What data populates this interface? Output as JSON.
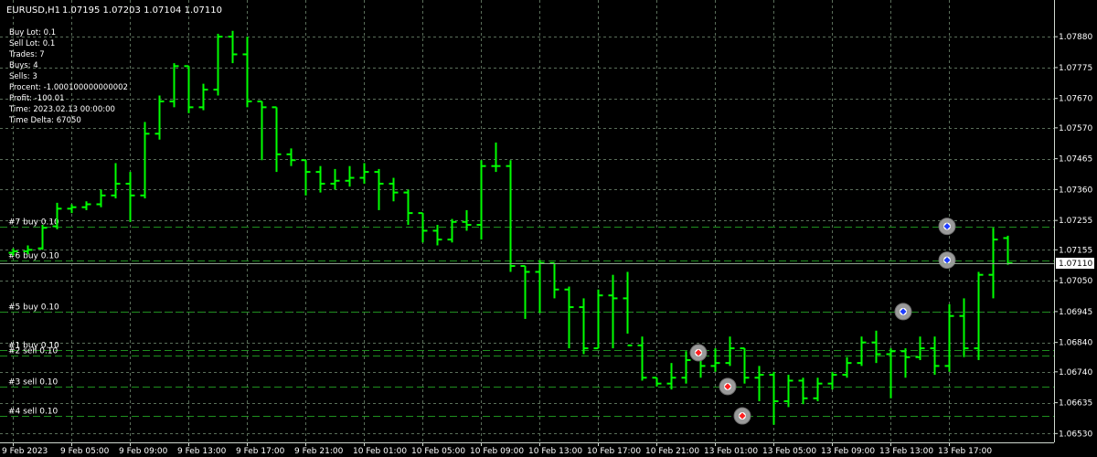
{
  "header": {
    "symbol": "EURUSD,H1",
    "ohlc": "1.07195 1.07203 1.07104 1.07110"
  },
  "info_panel": [
    "Buy Lot: 0.1",
    "Sell Lot: 0.1",
    "Trades: 7",
    "Buys: 4",
    "Sells: 3",
    "Procent: -1.000100000000002",
    "Profit: -100.01",
    "Time: 2023.02.13 00:00:00",
    "Time Delta: 67050"
  ],
  "current_price": "1.07110",
  "colors": {
    "background": "#000000",
    "grid": "#5a6e5a",
    "bar": "#00ff00",
    "order_line": "#1f8f1f",
    "price_label_bg": "#ffffff"
  },
  "order_labels": [
    {
      "text": "#7 buy 0.10",
      "price": 1.07235
    },
    {
      "text": "#6 buy 0.10",
      "price": 1.0712
    },
    {
      "text": "#5 buy 0.10",
      "price": 1.06945
    },
    {
      "text": "#1 buy 0.10",
      "price": 1.06815
    },
    {
      "text": "#2 sell 0.10",
      "price": 1.06795
    },
    {
      "text": "#3 sell 0.10",
      "price": 1.0669
    },
    {
      "text": "#4 sell 0.10",
      "price": 1.0659
    }
  ],
  "trade_markers": [
    {
      "type": "sell",
      "bar": 47,
      "price": 1.06805
    },
    {
      "type": "sell",
      "bar": 49,
      "price": 1.0669
    },
    {
      "type": "sell",
      "bar": 50,
      "price": 1.0659
    },
    {
      "type": "buy",
      "bar": 61,
      "price": 1.06945
    },
    {
      "type": "buy",
      "bar": 64,
      "price": 1.0712
    },
    {
      "type": "buy",
      "bar": 64,
      "price": 1.07235
    }
  ],
  "chart_data": {
    "type": "ohlc",
    "symbol": "EURUSD",
    "timeframe": "H1",
    "ylim": [
      1.065,
      1.0798
    ],
    "y_ticks": [
      "1.07880",
      "1.07775",
      "1.07670",
      "1.07570",
      "1.07465",
      "1.07360",
      "1.07255",
      "1.07155",
      "1.07050",
      "1.06945",
      "1.06840",
      "1.06740",
      "1.06635",
      "1.06530"
    ],
    "x_ticks": [
      {
        "label": "9 Feb 2023",
        "bar": 0
      },
      {
        "label": "9 Feb 05:00",
        "bar": 4
      },
      {
        "label": "9 Feb 09:00",
        "bar": 8
      },
      {
        "label": "9 Feb 13:00",
        "bar": 12
      },
      {
        "label": "9 Feb 17:00",
        "bar": 16
      },
      {
        "label": "9 Feb 21:00",
        "bar": 20
      },
      {
        "label": "10 Feb 01:00",
        "bar": 24
      },
      {
        "label": "10 Feb 05:00",
        "bar": 28
      },
      {
        "label": "10 Feb 09:00",
        "bar": 32
      },
      {
        "label": "10 Feb 13:00",
        "bar": 36
      },
      {
        "label": "10 Feb 17:00",
        "bar": 40
      },
      {
        "label": "10 Feb 21:00",
        "bar": 44
      },
      {
        "label": "13 Feb 01:00",
        "bar": 48
      },
      {
        "label": "13 Feb 05:00",
        "bar": 52
      },
      {
        "label": "13 Feb 09:00",
        "bar": 56
      },
      {
        "label": "13 Feb 13:00",
        "bar": 60
      },
      {
        "label": "13 Feb 17:00",
        "bar": 64
      }
    ],
    "bars": [
      [
        1.07145,
        1.0716,
        1.07135,
        1.0715
      ],
      [
        1.0715,
        1.0717,
        1.0714,
        1.07155
      ],
      [
        1.0716,
        1.0724,
        1.07155,
        1.0723
      ],
      [
        1.07235,
        1.07315,
        1.07225,
        1.07295
      ],
      [
        1.07295,
        1.0731,
        1.0728,
        1.073
      ],
      [
        1.073,
        1.0732,
        1.0729,
        1.0731
      ],
      [
        1.0731,
        1.0736,
        1.073,
        1.0734
      ],
      [
        1.0734,
        1.0745,
        1.0733,
        1.0738
      ],
      [
        1.0738,
        1.0742,
        1.0725,
        1.0734
      ],
      [
        1.0734,
        1.0759,
        1.0733,
        1.0755
      ],
      [
        1.0755,
        1.0768,
        1.0753,
        1.0766
      ],
      [
        1.0766,
        1.0779,
        1.0764,
        1.0778
      ],
      [
        1.0778,
        1.0778,
        1.0762,
        1.0764
      ],
      [
        1.0764,
        1.0772,
        1.0763,
        1.077
      ],
      [
        1.077,
        1.0789,
        1.0768,
        1.0788
      ],
      [
        1.0788,
        1.079,
        1.0779,
        1.0782
      ],
      [
        1.0782,
        1.0788,
        1.0764,
        1.0766
      ],
      [
        1.0766,
        1.0766,
        1.0746,
        1.0764
      ],
      [
        1.0764,
        1.0764,
        1.0742,
        1.0748
      ],
      [
        1.0748,
        1.075,
        1.0744,
        1.0746
      ],
      [
        1.0746,
        1.0746,
        1.0734,
        1.0742
      ],
      [
        1.0742,
        1.0744,
        1.0735,
        1.0738
      ],
      [
        1.0738,
        1.0743,
        1.0736,
        1.0739
      ],
      [
        1.0739,
        1.0744,
        1.0737,
        1.074
      ],
      [
        1.074,
        1.0745,
        1.0738,
        1.0742
      ],
      [
        1.0742,
        1.0743,
        1.0729,
        1.0738
      ],
      [
        1.0738,
        1.074,
        1.0732,
        1.0735
      ],
      [
        1.0735,
        1.0736,
        1.0724,
        1.0728
      ],
      [
        1.0728,
        1.0728,
        1.0718,
        1.0722
      ],
      [
        1.0722,
        1.0724,
        1.0717,
        1.0719
      ],
      [
        1.0719,
        1.0726,
        1.0718,
        1.0725
      ],
      [
        1.0725,
        1.0729,
        1.0722,
        1.0724
      ],
      [
        1.0724,
        1.0746,
        1.0719,
        1.0744
      ],
      [
        1.0744,
        1.0752,
        1.0742,
        1.0744
      ],
      [
        1.0744,
        1.0746,
        1.0708,
        1.071
      ],
      [
        1.071,
        1.071,
        1.0692,
        1.0708
      ],
      [
        1.0708,
        1.0712,
        1.0694,
        1.0711
      ],
      [
        1.0711,
        1.0711,
        1.0699,
        1.0702
      ],
      [
        1.0702,
        1.0703,
        1.0682,
        1.0696
      ],
      [
        1.0696,
        1.0699,
        1.068,
        1.0682
      ],
      [
        1.0682,
        1.0702,
        1.0682,
        1.07
      ],
      [
        1.07,
        1.0707,
        1.0682,
        1.0699
      ],
      [
        1.0699,
        1.0708,
        1.0687,
        1.0683
      ],
      [
        1.0683,
        1.0686,
        1.0671,
        1.0672
      ],
      [
        1.0672,
        1.0672,
        1.0669,
        1.067
      ],
      [
        1.067,
        1.0677,
        1.0668,
        1.0672
      ],
      [
        1.0672,
        1.0681,
        1.067,
        1.0678
      ],
      [
        1.0678,
        1.0681,
        1.0672,
        1.0676
      ],
      [
        1.0676,
        1.0682,
        1.0674,
        1.0677
      ],
      [
        1.0677,
        1.0686,
        1.0676,
        1.0682
      ],
      [
        1.0682,
        1.0682,
        1.067,
        1.0672
      ],
      [
        1.0672,
        1.0676,
        1.0664,
        1.0673
      ],
      [
        1.0673,
        1.0674,
        1.0656,
        1.0664
      ],
      [
        1.0664,
        1.0673,
        1.0662,
        1.0671
      ],
      [
        1.0671,
        1.0672,
        1.0663,
        1.0665
      ],
      [
        1.0665,
        1.0672,
        1.0664,
        1.067
      ],
      [
        1.067,
        1.0674,
        1.0668,
        1.0673
      ],
      [
        1.0673,
        1.0679,
        1.0672,
        1.0677
      ],
      [
        1.0677,
        1.0686,
        1.0676,
        1.0684
      ],
      [
        1.0684,
        1.0688,
        1.0677,
        1.068
      ],
      [
        1.068,
        1.0682,
        1.0665,
        1.0681
      ],
      [
        1.0681,
        1.0682,
        1.0672,
        1.0679
      ],
      [
        1.0679,
        1.0686,
        1.0678,
        1.0682
      ],
      [
        1.0682,
        1.0686,
        1.0673,
        1.0676
      ],
      [
        1.0676,
        1.0697,
        1.0674,
        1.0693
      ],
      [
        1.0693,
        1.0699,
        1.0679,
        1.0682
      ],
      [
        1.0682,
        1.0708,
        1.0678,
        1.0707
      ],
      [
        1.0707,
        1.0723,
        1.0699,
        1.0719
      ],
      [
        1.07195,
        1.07203,
        1.07104,
        1.0711
      ]
    ]
  }
}
